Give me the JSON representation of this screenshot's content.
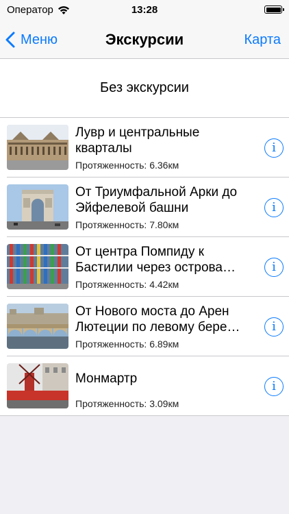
{
  "status": {
    "carrier": "Оператор",
    "time": "13:28"
  },
  "nav": {
    "back_label": "Меню",
    "title": "Экскурсии",
    "map_label": "Карта"
  },
  "no_tour_label": "Без экскурсии",
  "tours": [
    {
      "title": "Лувр и центральные кварталы",
      "length": "Протяженность: 6.36км",
      "thumb": "louvre-photo"
    },
    {
      "title": "От Триумфальной Арки до Эйфелевой башни",
      "length": "Протяженность: 7.80км",
      "thumb": "arc-de-triomphe-photo"
    },
    {
      "title": "От центра Помпиду к Бастилии через острова…",
      "length": "Протяженность: 4.42км",
      "thumb": "pompidou-photo"
    },
    {
      "title": "От Нового моста до Арен Лютеции по левому бере…",
      "length": "Протяженность: 6.89км",
      "thumb": "pont-neuf-photo"
    },
    {
      "title": "Монмартр",
      "length": "Протяженность: 3.09км",
      "thumb": "moulin-rouge-photo"
    }
  ],
  "colors": {
    "accent": "#0a7aff",
    "background": "#efeff4",
    "separator": "#c8c7cc"
  }
}
